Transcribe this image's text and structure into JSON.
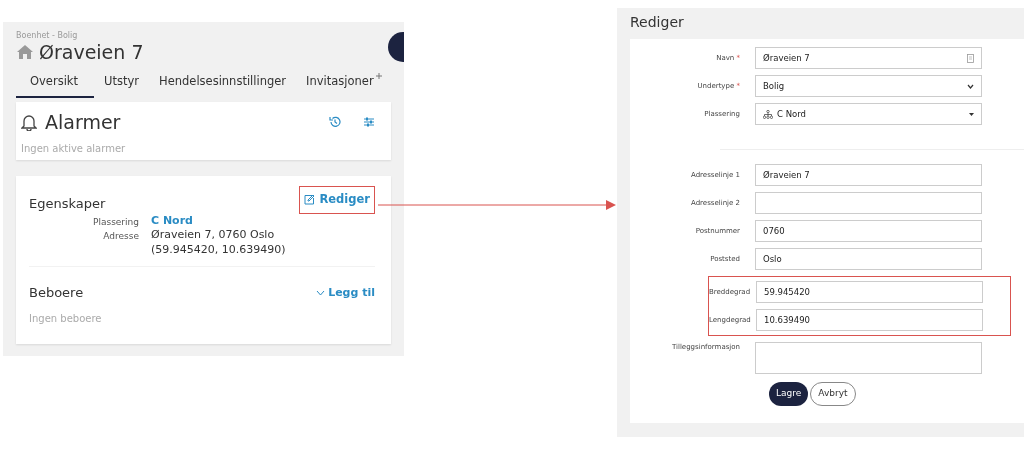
{
  "overview": {
    "breadcrumb": "Boenhet - Bolig",
    "title": "Øraveien 7",
    "tabs": [
      {
        "label": "Oversikt",
        "selected": true,
        "icon": false
      },
      {
        "label": "Utstyr",
        "selected": false,
        "icon": false
      },
      {
        "label": "Hendelsesinnstillinger",
        "selected": false,
        "icon": false
      },
      {
        "label": "Invitasjoner",
        "selected": false,
        "icon": true
      }
    ],
    "alarms": {
      "title": "Alarmer",
      "empty": "Ingen aktive alarmer"
    },
    "properties": {
      "title": "Egenskaper",
      "edit_label": "Rediger",
      "edit_highlighted": true,
      "fields": [
        {
          "label": "Plassering",
          "kind": "link",
          "value": "C Nord"
        },
        {
          "label": "Adresse",
          "kind": "text",
          "value": "Øraveien 7, 0760 Oslo",
          "extra": "(59.945420, 10.639490)"
        }
      ]
    },
    "residents": {
      "title": "Beboere",
      "action": "Legg til",
      "empty": "Ingen beboere"
    }
  },
  "edit_form": {
    "title": "Rediger",
    "groups": [
      [
        {
          "label": "Navn",
          "required_mark": "*",
          "kind": "text",
          "value": "Øraveien 7",
          "highlighted": false
        },
        {
          "label": "Undertype",
          "required_mark": "*",
          "kind": "select",
          "value": "Bolig",
          "highlighted": false
        },
        {
          "label": "Plassering",
          "kind": "tree-select",
          "value": "C Nord",
          "highlighted": false
        }
      ],
      [
        {
          "label": "Adresselinje 1",
          "kind": "input",
          "value": "Øraveien 7",
          "highlighted": false
        },
        {
          "label": "Adresselinje 2",
          "kind": "input",
          "highlighted": false
        },
        {
          "label": "Postnummer",
          "kind": "input",
          "value": "0760",
          "highlighted": false
        },
        {
          "label": "Poststed",
          "kind": "input",
          "value": "Oslo",
          "highlighted": false
        },
        {
          "label": "Breddegrad",
          "kind": "input",
          "value": "59.945420",
          "highlighted": true
        },
        {
          "label": "Lengdegrad",
          "kind": "input",
          "value": "10.639490",
          "highlighted": true
        },
        {
          "label": "Tilleggsinformasjon",
          "kind": "textarea",
          "highlighted": false
        }
      ]
    ],
    "buttons": [
      {
        "label": "Lagre",
        "kind": "primary"
      },
      {
        "label": "Avbryt",
        "kind": "secondary"
      }
    ]
  }
}
